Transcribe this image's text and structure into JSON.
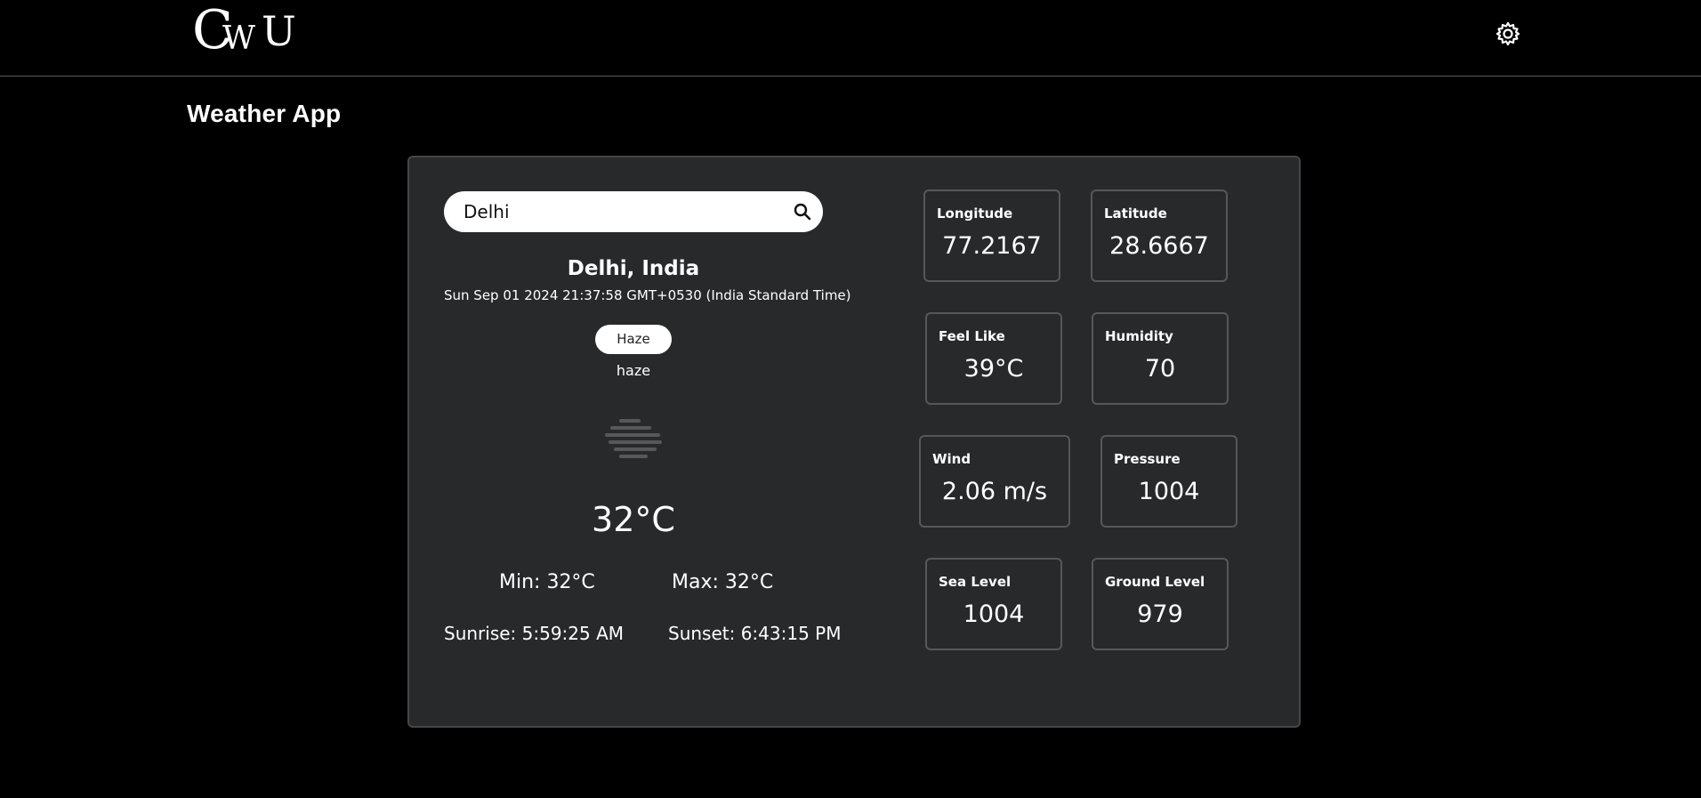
{
  "header": {
    "logo": "CWU",
    "settings_icon": "gear-icon"
  },
  "page": {
    "title": "Weather App"
  },
  "search": {
    "value": "Delhi",
    "icon": "search-icon"
  },
  "weather": {
    "location": "Delhi, India",
    "datetime": "Sun Sep 01 2024 21:37:58 GMT+0530 (India Standard Time)",
    "condition": "Haze",
    "description": "haze",
    "icon": "haze-icon",
    "temperature": "32°C",
    "min": "Min: 32°C",
    "max": "Max: 32°C",
    "sunrise": "Sunrise: 5:59:25 AM",
    "sunset": "Sunset: 6:43:15 PM"
  },
  "stats": {
    "longitude": {
      "label": "Longitude",
      "value": "77.2167"
    },
    "latitude": {
      "label": "Latitude",
      "value": "28.6667"
    },
    "feels_like": {
      "label": "Feel Like",
      "value": "39°C"
    },
    "humidity": {
      "label": "Humidity",
      "value": "70"
    },
    "wind": {
      "label": "Wind",
      "value": "2.06 m/s"
    },
    "pressure": {
      "label": "Pressure",
      "value": "1004"
    },
    "sea_level": {
      "label": "Sea Level",
      "value": "1004"
    },
    "ground_level": {
      "label": "Ground Level",
      "value": "979"
    }
  },
  "colors": {
    "background": "#000000",
    "card": "#28292b",
    "card_border": "#444648",
    "stat_border": "#55585b",
    "text": "#ffffff"
  }
}
